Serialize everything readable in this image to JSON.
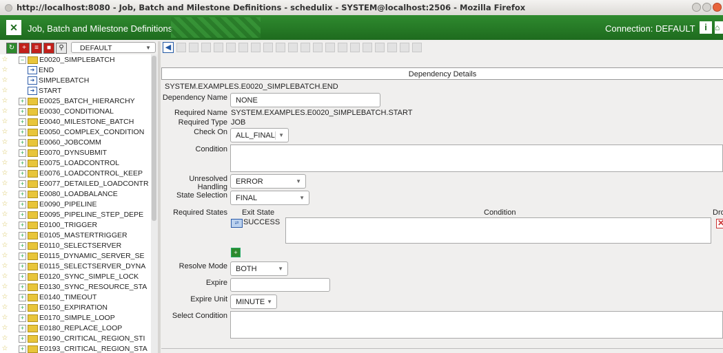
{
  "browser": {
    "title": "http://localhost:8080 - Job, Batch and Milestone Definitions - schedulix - SYSTEM@localhost:2506 - Mozilla Firefox"
  },
  "app": {
    "title": "Job, Batch and Milestone Definitions",
    "connection": "Connection: DEFAULT",
    "info_label": "i",
    "brand_color": "#1e6b1e"
  },
  "left_toolbar": {
    "combo_value": "DEFAULT"
  },
  "tree": {
    "items": [
      {
        "label": "E0020_SIMPLEBATCH",
        "kind": "folder-open",
        "indent": 0
      },
      {
        "label": "END",
        "kind": "leaf",
        "indent": 2
      },
      {
        "label": "SIMPLEBATCH",
        "kind": "leaf",
        "indent": 2
      },
      {
        "label": "START",
        "kind": "leaf",
        "indent": 2
      },
      {
        "label": "E0025_BATCH_HIERARCHY",
        "kind": "folder",
        "indent": 0
      },
      {
        "label": "E0030_CONDITIONAL",
        "kind": "folder",
        "indent": 0
      },
      {
        "label": "E0040_MILESTONE_BATCH",
        "kind": "folder",
        "indent": 0
      },
      {
        "label": "E0050_COMPLEX_CONDITION",
        "kind": "folder",
        "indent": 0
      },
      {
        "label": "E0060_JOBCOMM",
        "kind": "folder",
        "indent": 0
      },
      {
        "label": "E0070_DYNSUBMIT",
        "kind": "folder",
        "indent": 0
      },
      {
        "label": "E0075_LOADCONTROL",
        "kind": "folder",
        "indent": 0
      },
      {
        "label": "E0076_LOADCONTROL_KEEP",
        "kind": "folder",
        "indent": 0
      },
      {
        "label": "E0077_DETAILED_LOADCONTR",
        "kind": "folder",
        "indent": 0
      },
      {
        "label": "E0080_LOADBALANCE",
        "kind": "folder",
        "indent": 0
      },
      {
        "label": "E0090_PIPELINE",
        "kind": "folder",
        "indent": 0
      },
      {
        "label": "E0095_PIPELINE_STEP_DEPE",
        "kind": "folder",
        "indent": 0
      },
      {
        "label": "E0100_TRIGGER",
        "kind": "folder",
        "indent": 0
      },
      {
        "label": "E0105_MASTERTRIGGER",
        "kind": "folder",
        "indent": 0
      },
      {
        "label": "E0110_SELECTSERVER",
        "kind": "folder",
        "indent": 0
      },
      {
        "label": "E0115_DYNAMIC_SERVER_SE",
        "kind": "folder",
        "indent": 0
      },
      {
        "label": "E0115_SELECTSERVER_DYNA",
        "kind": "folder",
        "indent": 0
      },
      {
        "label": "E0120_SYNC_SIMPLE_LOCK",
        "kind": "folder",
        "indent": 0
      },
      {
        "label": "E0130_SYNC_RESOURCE_STA",
        "kind": "folder",
        "indent": 0
      },
      {
        "label": "E0140_TIMEOUT",
        "kind": "folder",
        "indent": 0
      },
      {
        "label": "E0150_EXPIRATION",
        "kind": "folder",
        "indent": 0
      },
      {
        "label": "E0170_SIMPLE_LOOP",
        "kind": "folder",
        "indent": 0
      },
      {
        "label": "E0180_REPLACE_LOOP",
        "kind": "folder",
        "indent": 0
      },
      {
        "label": "E0190_CRITICAL_REGION_STI",
        "kind": "folder",
        "indent": 0
      },
      {
        "label": "E0193_CRITICAL_REGION_STA",
        "kind": "folder",
        "indent": 0
      }
    ]
  },
  "details": {
    "header": "Dependency Details",
    "full_name": "SYSTEM.EXAMPLES.E0020_SIMPLEBATCH.END",
    "dependency_name_label": "Dependency Name",
    "dependency_name_value": "NONE",
    "required_name_label": "Required Name",
    "required_name_value": "SYSTEM.EXAMPLES.E0020_SIMPLEBATCH.START",
    "required_type_label": "Required Type",
    "required_type_value": "JOB",
    "check_on_label": "Check On",
    "check_on_value": "ALL_FINAL",
    "condition_label": "Condition",
    "unresolved_label": "Unresolved Handling",
    "unresolved_value": "ERROR",
    "state_selection_label": "State Selection",
    "state_selection_value": "FINAL",
    "required_states_label": "Required States",
    "col_exit_state": "Exit State",
    "col_condition": "Condition",
    "col_drop": "Dro",
    "state_row_value": "SUCCESS",
    "resolve_mode_label": "Resolve Mode",
    "resolve_mode_value": "BOTH",
    "expire_label": "Expire",
    "expire_value": "",
    "expire_unit_label": "Expire Unit",
    "expire_unit_value": "MINUTE",
    "select_condition_label": "Select Condition"
  }
}
